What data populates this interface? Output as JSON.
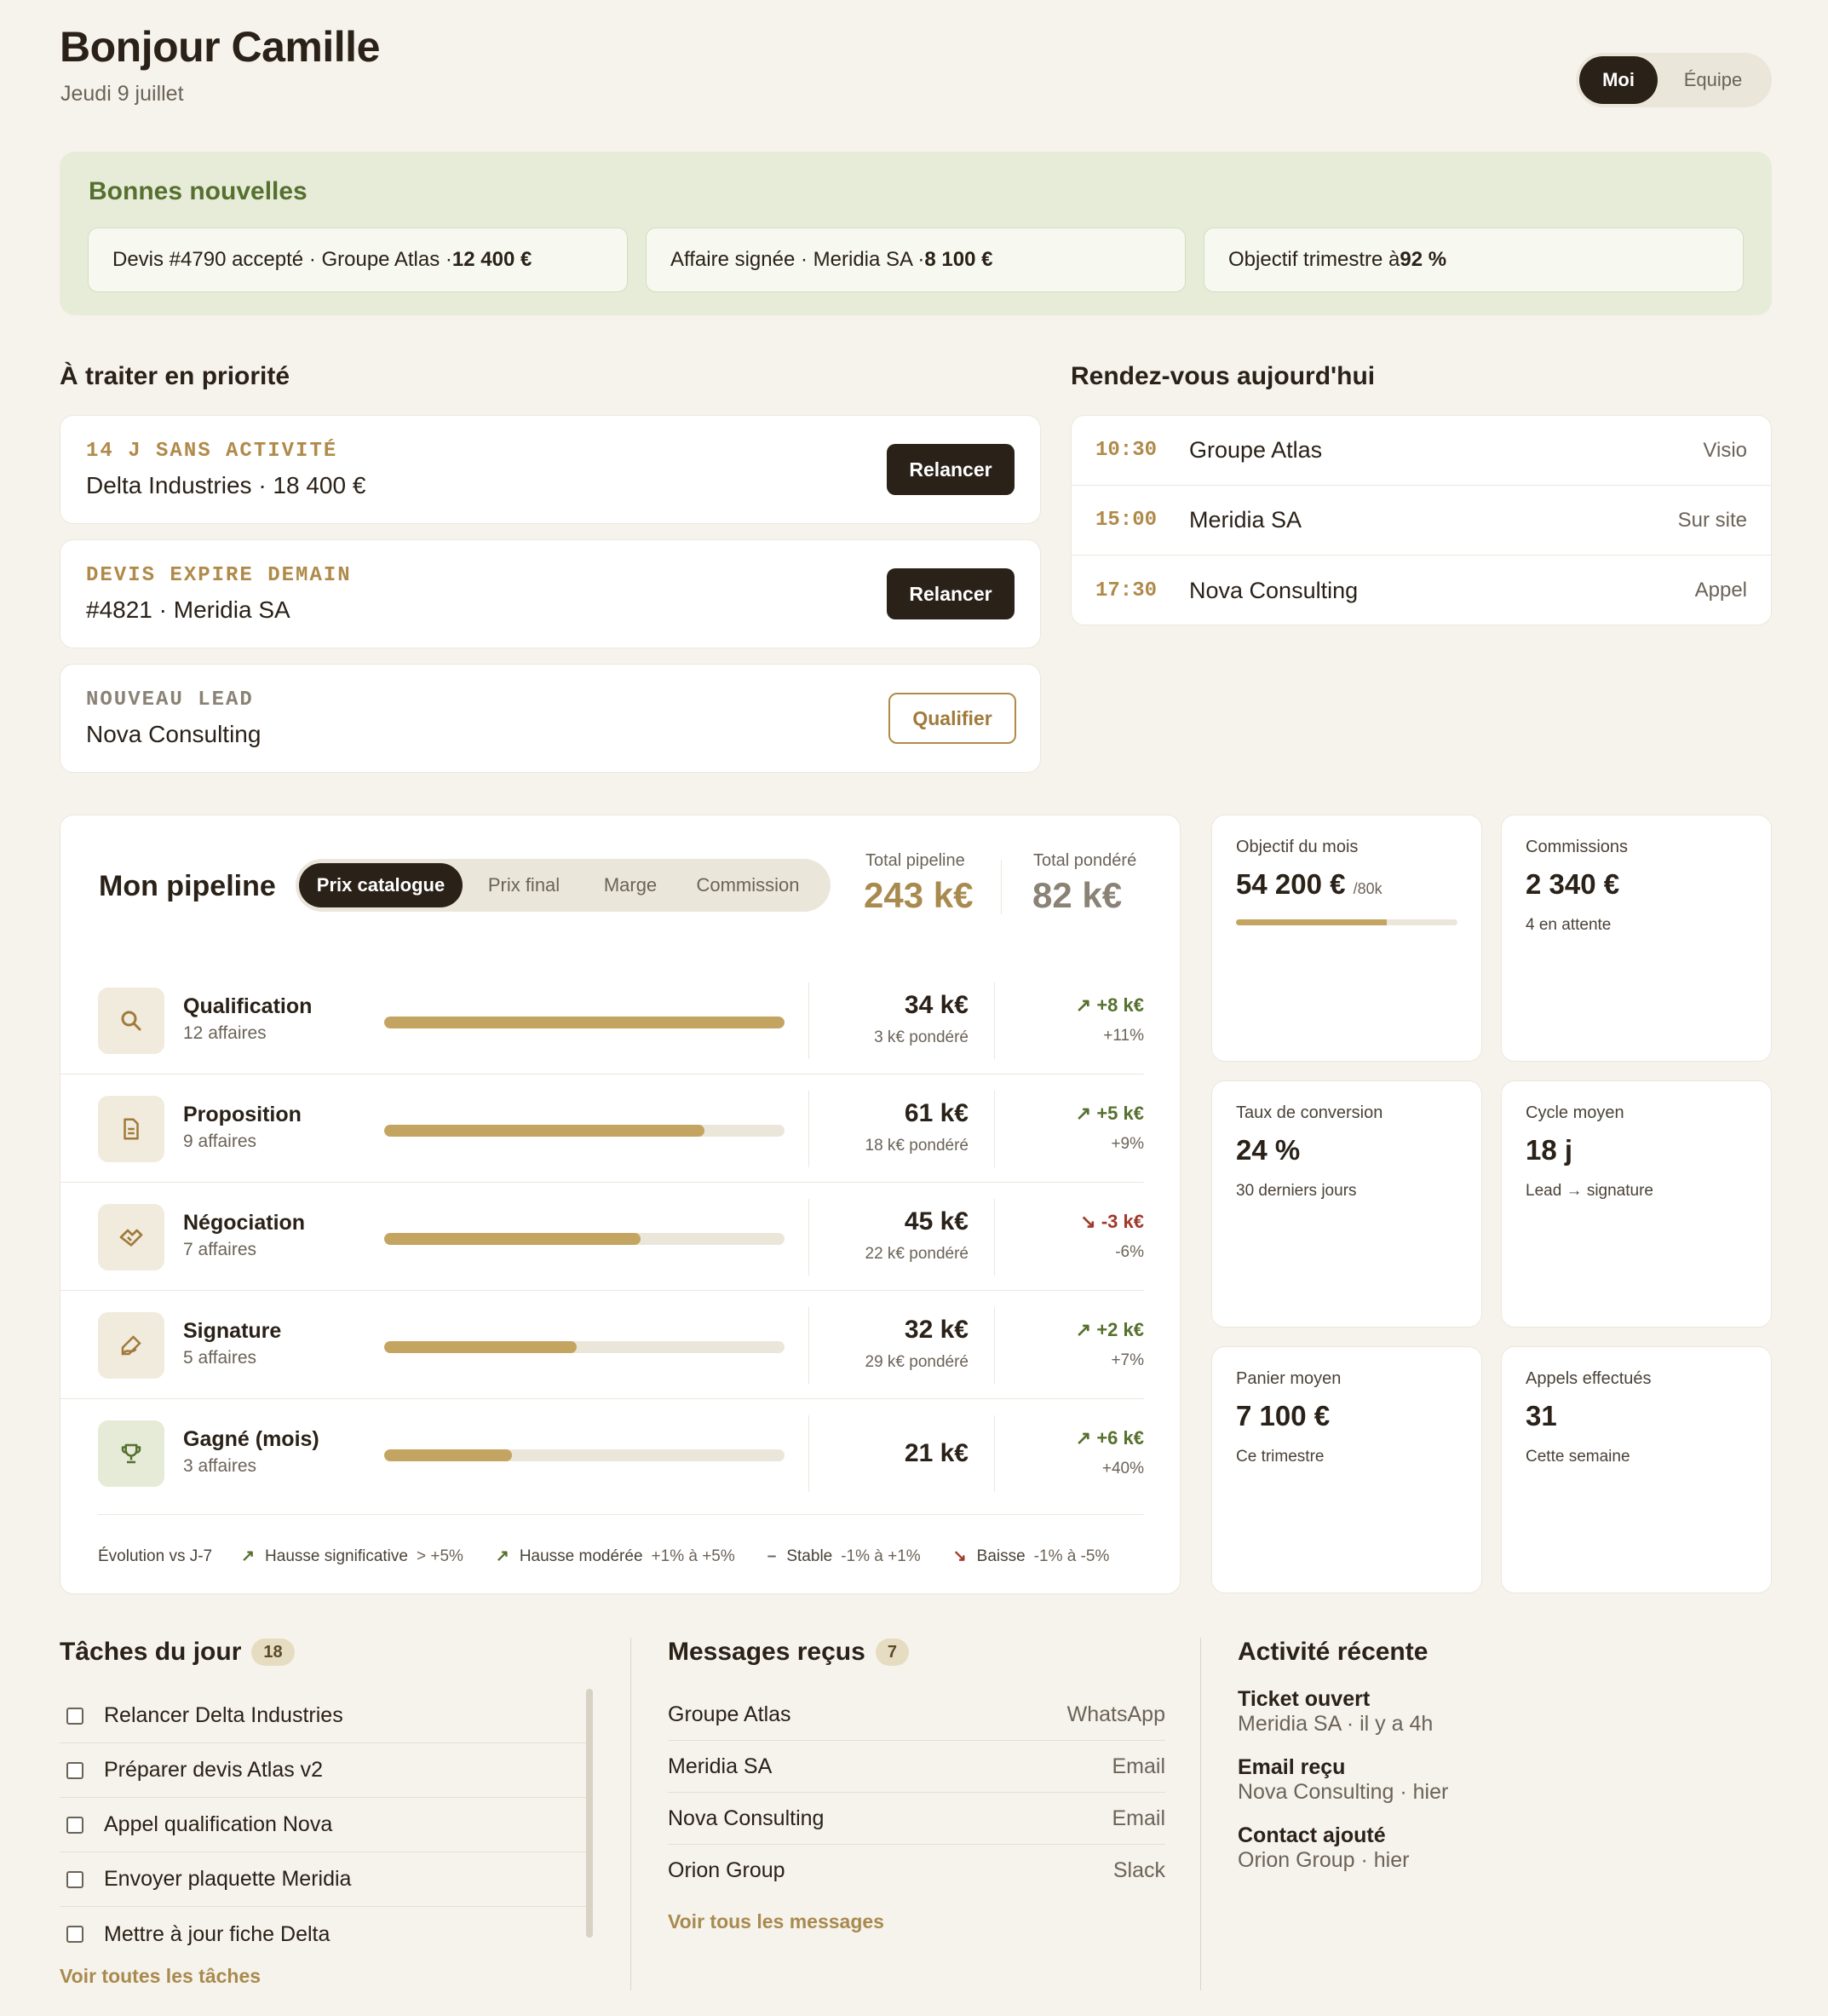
{
  "header": {
    "greeting": "Bonjour Camille",
    "date": "Jeudi 9 juillet",
    "toggle": [
      "Moi",
      "Équipe"
    ]
  },
  "news": {
    "title": "Bonnes nouvelles",
    "items": [
      {
        "text": "Devis #4790 accepté · Groupe Atlas · ",
        "bold": "12 400 €"
      },
      {
        "text": "Affaire signée · Meridia SA · ",
        "bold": "8 100 €"
      },
      {
        "text": "Objectif trimestre à ",
        "bold": "92 %"
      }
    ]
  },
  "priority": {
    "title": "À traiter en priorité",
    "items": [
      {
        "tag": "14 J SANS ACTIVITÉ",
        "name": "Delta Industries · 18 400 €",
        "action": "Relancer"
      },
      {
        "tag": "DEVIS EXPIRE DEMAIN",
        "name": "#4821 · Meridia SA",
        "action": "Relancer"
      },
      {
        "tag": "NOUVEAU LEAD",
        "name": "Nova Consulting",
        "action": "Qualifier"
      }
    ]
  },
  "appointments": {
    "title": "Rendez-vous aujourd'hui",
    "items": [
      {
        "time": "10:30",
        "name": "Groupe Atlas",
        "type": "Visio"
      },
      {
        "time": "15:00",
        "name": "Meridia SA",
        "type": "Sur site"
      },
      {
        "time": "17:30",
        "name": "Nova Consulting",
        "type": "Appel"
      }
    ]
  },
  "pipeline": {
    "title": "Mon pipeline",
    "tabs": [
      "Prix catalogue",
      "Prix final",
      "Marge",
      "Commission"
    ],
    "total_label": "Total pipeline",
    "total": "243 k€",
    "weighted_label": "Total pondéré",
    "weighted": "82 k€",
    "stages": [
      {
        "name": "Qualification",
        "count": "12 affaires",
        "value": "34 k€",
        "weighted": "3 k€ pondéré",
        "delta": "+8 k€",
        "pct": "+11%",
        "dir": "up",
        "fill": 1.0,
        "icon": "search-icon"
      },
      {
        "name": "Proposition",
        "count": "9 affaires",
        "value": "61 k€",
        "weighted": "18 k€ pondéré",
        "delta": "+5 k€",
        "pct": "+9%",
        "dir": "up",
        "fill": 0.8,
        "icon": "document-icon"
      },
      {
        "name": "Négociation",
        "count": "7 affaires",
        "value": "45 k€",
        "weighted": "22 k€ pondéré",
        "delta": "-3 k€",
        "pct": "-6%",
        "dir": "down",
        "fill": 0.64,
        "icon": "handshake-icon"
      },
      {
        "name": "Signature",
        "count": "5 affaires",
        "value": "32 k€",
        "weighted": "29 k€ pondéré",
        "delta": "+2 k€",
        "pct": "+7%",
        "dir": "up",
        "fill": 0.48,
        "icon": "signature-icon"
      },
      {
        "name": "Gagné (mois)",
        "count": "3 affaires",
        "value": "21 k€",
        "weighted": "",
        "delta": "+6 k€",
        "pct": "+40%",
        "dir": "up",
        "fill": 0.32,
        "icon": "trophy-icon"
      }
    ],
    "legend": {
      "label": "Évolution vs J-7",
      "items": [
        {
          "name": "Hausse significative",
          "range": "> +5%"
        },
        {
          "name": "Hausse modérée",
          "range": "+1% à +5%"
        },
        {
          "name": "Stable",
          "range": "-1% à +1%"
        },
        {
          "name": "Baisse",
          "range": "-1% à -5%"
        }
      ]
    }
  },
  "kpis": [
    {
      "label": "Objectif du mois",
      "value": "54 200 €",
      "suffix": "/80k",
      "sub": "",
      "progress": 0.68
    },
    {
      "label": "Commissions",
      "value": "2 340 €",
      "sub": "4 en attente"
    },
    {
      "label": "Taux de conversion",
      "value": "24 %",
      "sub": "30 derniers jours"
    },
    {
      "label": "Cycle moyen",
      "value": "18 j",
      "sub": "Lead → signature"
    },
    {
      "label": "Panier moyen",
      "value": "7 100 €",
      "sub": "Ce trimestre"
    },
    {
      "label": "Appels effectués",
      "value": "31",
      "sub": "Cette semaine"
    }
  ],
  "tasks": {
    "title": "Tâches du jour",
    "count": "18",
    "items": [
      "Relancer Delta Industries",
      "Préparer devis Atlas v2",
      "Appel qualification Nova",
      "Envoyer plaquette Meridia",
      "Mettre à jour fiche Delta"
    ],
    "link": "Voir toutes les tâches"
  },
  "messages": {
    "title": "Messages reçus",
    "count": "7",
    "items": [
      {
        "name": "Groupe Atlas",
        "channel": "WhatsApp"
      },
      {
        "name": "Meridia SA",
        "channel": "Email"
      },
      {
        "name": "Nova Consulting",
        "channel": "Email"
      },
      {
        "name": "Orion Group",
        "channel": "Slack"
      }
    ],
    "link": "Voir tous les messages"
  },
  "activity": {
    "title": "Activité récente",
    "items": [
      {
        "title": "Ticket ouvert",
        "sub": "Meridia SA · il y a 4h"
      },
      {
        "title": "Email reçu",
        "sub": "Nova Consulting · hier"
      },
      {
        "title": "Contact ajouté",
        "sub": "Orion Group · hier"
      }
    ]
  },
  "colors": {
    "accent": "#c4a461",
    "dark": "#2a2118",
    "positive": "#56702e",
    "negative": "#a0392b",
    "background": "#f6f3ec"
  }
}
